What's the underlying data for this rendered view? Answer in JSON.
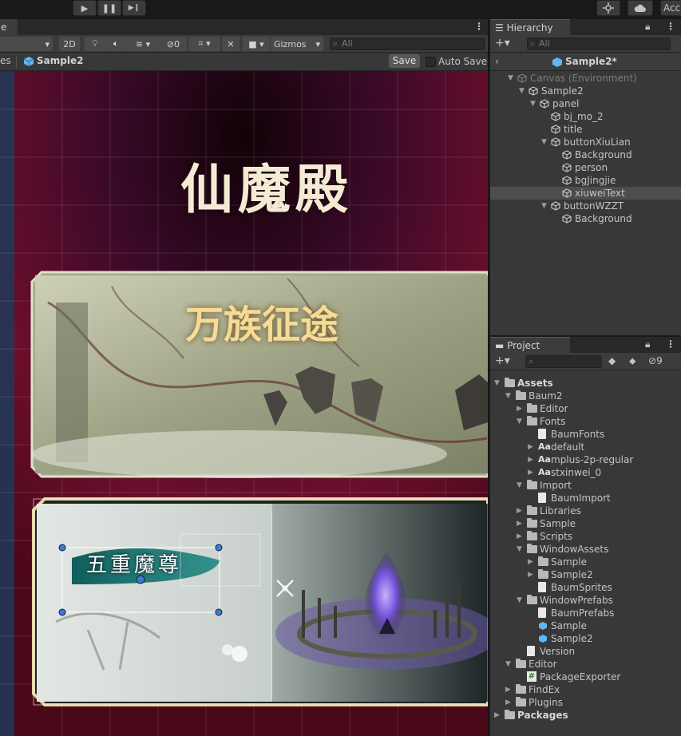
{
  "toolbar": {
    "play_label": "▶",
    "pause_label": "❚❚",
    "step_label": "▶❙",
    "account_label": "Acc"
  },
  "scene": {
    "tab_label": "e",
    "mode_2d": "2D",
    "gizmos_label": "Gizmos",
    "hidden_count": "0",
    "search_placeholder": "All",
    "breadcrumb_prev": "es",
    "prefab_name": "Sample2",
    "save_label": "Save",
    "auto_save_label": "Auto Save",
    "title_text": "仙魔殿",
    "banner1_text": "万族征途",
    "banner2_text": "五重魔尊"
  },
  "hierarchy": {
    "tab_label": "Hierarchy",
    "search_placeholder": "All",
    "prefab_title": "Sample2*",
    "items": [
      {
        "label": "Canvas (Environment)",
        "depth": 0,
        "expanded": true,
        "dim": true
      },
      {
        "label": "Sample2",
        "depth": 1,
        "expanded": true
      },
      {
        "label": "panel",
        "depth": 2,
        "expanded": true
      },
      {
        "label": "bj_mo_2",
        "depth": 3
      },
      {
        "label": "title",
        "depth": 3
      },
      {
        "label": "buttonXiuLian",
        "depth": 3,
        "expanded": true
      },
      {
        "label": "Background",
        "depth": 4
      },
      {
        "label": "person",
        "depth": 4
      },
      {
        "label": "bgJingjie",
        "depth": 4
      },
      {
        "label": "xiuweiText",
        "depth": 4,
        "selected": true
      },
      {
        "label": "buttonWZZT",
        "depth": 3,
        "expanded": true
      },
      {
        "label": "Background",
        "depth": 4
      }
    ]
  },
  "project": {
    "tab_label": "Project",
    "hidden_count": "9",
    "items": [
      {
        "label": "Assets",
        "depth": 0,
        "kind": "folder",
        "expanded": true,
        "bold": true
      },
      {
        "label": "Baum2",
        "depth": 1,
        "kind": "folder",
        "expanded": true
      },
      {
        "label": "Editor",
        "depth": 2,
        "kind": "folder",
        "collapsed": true
      },
      {
        "label": "Fonts",
        "depth": 2,
        "kind": "folder",
        "expanded": true
      },
      {
        "label": "BaumFonts",
        "depth": 3,
        "kind": "doc"
      },
      {
        "label": "default",
        "depth": 3,
        "kind": "font",
        "collapsed": true
      },
      {
        "label": "mplus-2p-regular",
        "depth": 3,
        "kind": "font",
        "collapsed": true
      },
      {
        "label": "stxinwei_0",
        "depth": 3,
        "kind": "font",
        "collapsed": true
      },
      {
        "label": "Import",
        "depth": 2,
        "kind": "folder",
        "expanded": true
      },
      {
        "label": "BaumImport",
        "depth": 3,
        "kind": "doc"
      },
      {
        "label": "Libraries",
        "depth": 2,
        "kind": "folder",
        "collapsed": true
      },
      {
        "label": "Sample",
        "depth": 2,
        "kind": "folder",
        "collapsed": true
      },
      {
        "label": "Scripts",
        "depth": 2,
        "kind": "folder",
        "collapsed": true
      },
      {
        "label": "WindowAssets",
        "depth": 2,
        "kind": "folder",
        "expanded": true
      },
      {
        "label": "Sample",
        "depth": 3,
        "kind": "folder",
        "collapsed": true
      },
      {
        "label": "Sample2",
        "depth": 3,
        "kind": "folder",
        "collapsed": true
      },
      {
        "label": "BaumSprites",
        "depth": 3,
        "kind": "doc"
      },
      {
        "label": "WindowPrefabs",
        "depth": 2,
        "kind": "folder",
        "expanded": true
      },
      {
        "label": "BaumPrefabs",
        "depth": 3,
        "kind": "doc"
      },
      {
        "label": "Sample",
        "depth": 3,
        "kind": "prefab"
      },
      {
        "label": "Sample2",
        "depth": 3,
        "kind": "prefab"
      },
      {
        "label": "Version",
        "depth": 2,
        "kind": "doc"
      },
      {
        "label": "Editor",
        "depth": 1,
        "kind": "folder",
        "expanded": true
      },
      {
        "label": "PackageExporter",
        "depth": 2,
        "kind": "script"
      },
      {
        "label": "FindEx",
        "depth": 1,
        "kind": "folder",
        "collapsed": true
      },
      {
        "label": "Plugins",
        "depth": 1,
        "kind": "folder",
        "collapsed": true
      },
      {
        "label": "Packages",
        "depth": 0,
        "kind": "folder",
        "collapsed": true,
        "bold": true
      }
    ]
  },
  "colors": {
    "selection": "#2c5d87",
    "hover_row": "#4d4d4d",
    "prefab_blue": "#5fb8f0",
    "scene_bg": "#2a0618"
  }
}
